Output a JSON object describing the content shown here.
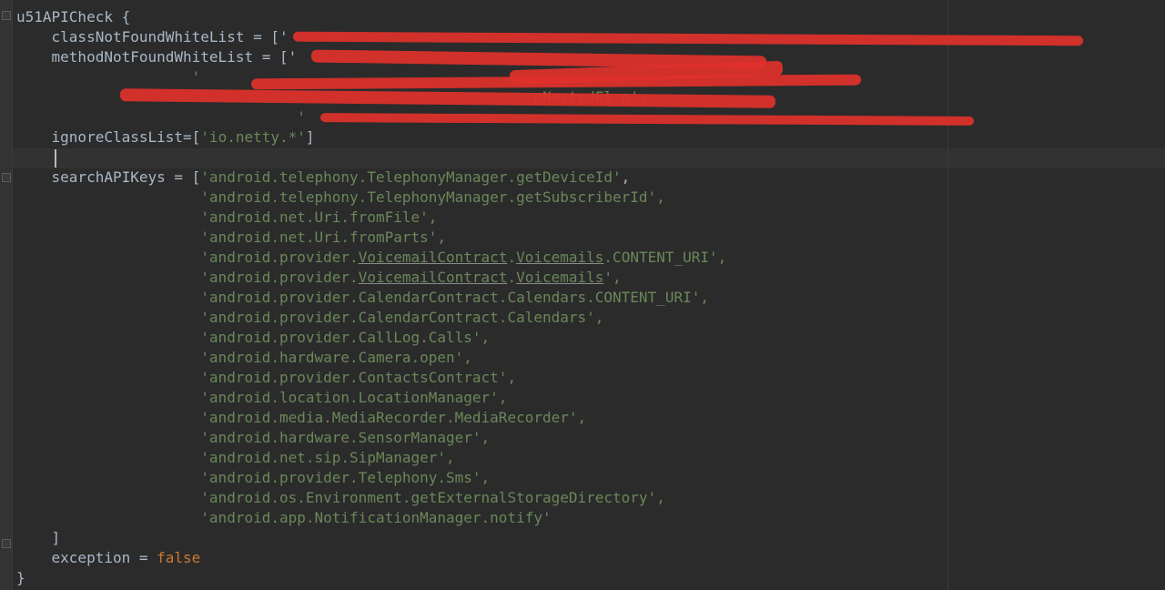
{
  "editor": {
    "lines": [
      {
        "text": "u51APICheck {"
      },
      {
        "text": "    classNotFoundWhiteList = ['"
      },
      {
        "text": "    methodNotFoundWhiteList = ['"
      },
      {
        "text": "                    '"
      },
      {
        "text": "                                                           oNestedFl g',"
      },
      {
        "text": "                                '"
      },
      {
        "text": "    ignoreClassList=['io.netty.*']"
      },
      {
        "text": ""
      },
      {
        "text": "    searchAPIKeys = ['android.telephony.TelephonyManager.getDeviceId',"
      },
      {
        "text": "                     'android.telephony.TelephonyManager.getSubscriberId',"
      },
      {
        "text": "                     'android.net.Uri.fromFile',"
      },
      {
        "text": "                     'android.net.Uri.fromParts',"
      },
      {
        "text": "                     'android.provider.VoicemailContract.Voicemails.CONTENT_URI',"
      },
      {
        "text": "                     'android.provider.VoicemailContract.Voicemails',"
      },
      {
        "text": "                     'android.provider.CalendarContract.Calendars.CONTENT_URI',"
      },
      {
        "text": "                     'android.provider.CalendarContract.Calendars',"
      },
      {
        "text": "                     'android.provider.CallLog.Calls',"
      },
      {
        "text": "                     'android.hardware.Camera.open',"
      },
      {
        "text": "                     'android.provider.ContactsContract',"
      },
      {
        "text": "                     'android.location.LocationManager',"
      },
      {
        "text": "                     'android.media.MediaRecorder.MediaRecorder',"
      },
      {
        "text": "                     'android.hardware.SensorManager',"
      },
      {
        "text": "                     'android.net.sip.SipManager',"
      },
      {
        "text": "                     'android.provider.Telephony.Sms',"
      },
      {
        "text": "                     'android.os.Environment.getExternalStorageDirectory',"
      },
      {
        "text": "                     'android.app.NotificationManager.notify'"
      },
      {
        "text": "    ]"
      },
      {
        "text": "    exception = false"
      },
      {
        "text": "}"
      }
    ],
    "keyword_false": "false",
    "redaction_color": "#e0312b",
    "background_color": "#2b2b2b",
    "string_color": "#6a8759",
    "keyword_color": "#cc7832"
  }
}
